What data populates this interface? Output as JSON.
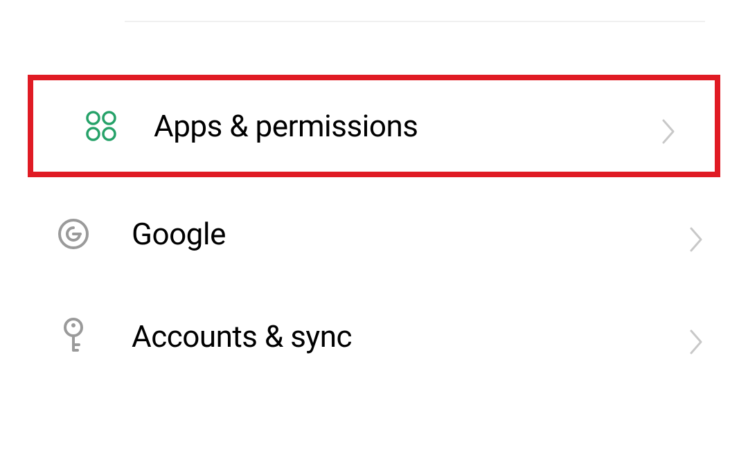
{
  "settings": {
    "items": [
      {
        "label": "Apps & permissions",
        "icon": "apps-icon",
        "highlighted": true
      },
      {
        "label": "Google",
        "icon": "google-icon",
        "highlighted": false
      },
      {
        "label": "Accounts & sync",
        "icon": "key-icon",
        "highlighted": false
      }
    ]
  },
  "colors": {
    "highlight_border": "#e01b24",
    "apps_icon": "#26a269",
    "neutral_icon": "#9a9a9a",
    "chevron": "#c0c0c0"
  }
}
